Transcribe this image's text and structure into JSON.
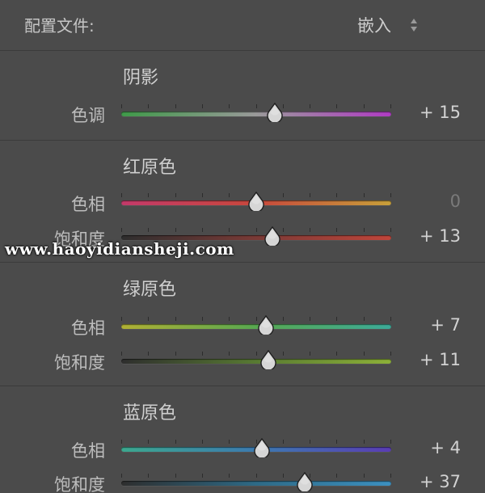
{
  "profile": {
    "label": "配置文件:",
    "value": "嵌入",
    "icon": "updown-chevron-icon"
  },
  "sections": [
    {
      "title": "阴影",
      "rows": [
        {
          "label": "色调",
          "value": "+ 15",
          "position": 0.57,
          "gradient": [
            "#3f9a49",
            "#9a9a9a",
            "#b03cc4"
          ]
        }
      ]
    },
    {
      "title": "红原色",
      "rows": [
        {
          "label": "色相",
          "value": "0",
          "position": 0.5,
          "gradient": [
            "#c33a6a",
            "#c8483c",
            "#c8a03a"
          ]
        },
        {
          "label": "饱和度",
          "value": "+ 13",
          "position": 0.56,
          "gradient": [
            "#2e2e2e",
            "#7a3a36",
            "#c0453a"
          ]
        }
      ]
    },
    {
      "title": "绿原色",
      "rows": [
        {
          "label": "色相",
          "value": "+ 7",
          "position": 0.535,
          "gradient": [
            "#b0b034",
            "#58a850",
            "#3caa98"
          ]
        },
        {
          "label": "饱和度",
          "value": "+ 11",
          "position": 0.545,
          "gradient": [
            "#2e2e2e",
            "#587a32",
            "#8cb038"
          ]
        }
      ]
    },
    {
      "title": "蓝原色",
      "rows": [
        {
          "label": "色相",
          "value": "+ 4",
          "position": 0.52,
          "gradient": [
            "#3ca88e",
            "#3c7ab0",
            "#5a3cb4"
          ]
        },
        {
          "label": "饱和度",
          "value": "+ 37",
          "position": 0.68,
          "gradient": [
            "#2e2e2e",
            "#2e6a86",
            "#3c90c0"
          ]
        }
      ]
    }
  ],
  "watermark": "www.haoyidiansheji.com"
}
